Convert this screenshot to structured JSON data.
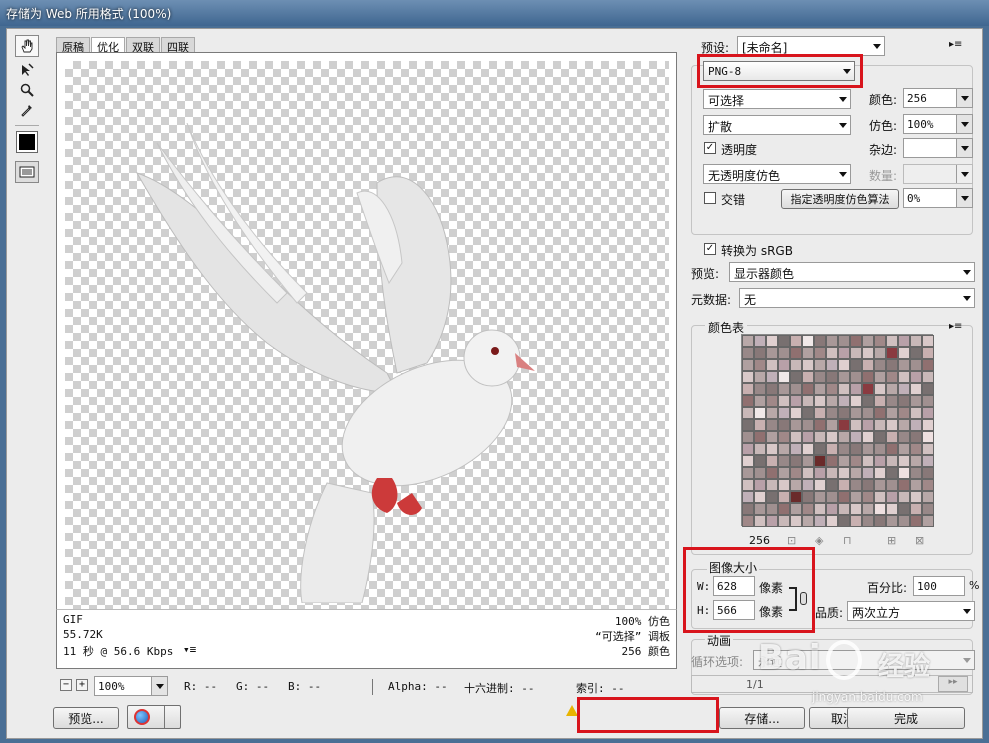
{
  "window": {
    "title": "存储为 Web 所用格式 (100%)"
  },
  "tabs": [
    "原稿",
    "优化",
    "双联",
    "四联"
  ],
  "info": {
    "format": "GIF",
    "size": "55.72K",
    "time": "11 秒 @ 56.6 Kbps",
    "dither": "100% 仿色",
    "palette": "“可选择” 调板",
    "colors": "256 颜色"
  },
  "status": {
    "zoom": "100%",
    "r": "R: --",
    "g": "G: --",
    "b": "B: --",
    "alpha": "Alpha: --",
    "hex": "十六进制: --",
    "index": "索引: --"
  },
  "buttons": {
    "preview": "预览...",
    "save": "存储...",
    "cancel": "取消",
    "done": "完成"
  },
  "settings": {
    "preset_label": "预设:",
    "preset_value": "[未命名]",
    "format": "PNG-8",
    "reduction": "可选择",
    "dither_algo": "扩散",
    "colors_label": "颜色:",
    "colors_value": "256",
    "dither_label": "仿色:",
    "dither_value": "100%",
    "transparency": "透明度",
    "matte_label": "杂边:",
    "matte_value": "",
    "trans_dither": "无透明度仿色",
    "amount_label": "数量:",
    "amount_value": "",
    "interlaced": "交错",
    "trans_dither_btn": "指定透明度仿色算法",
    "websnap_value": "0%",
    "convert_srgb": "转换为 sRGB",
    "preview_label": "预览:",
    "preview_value": "显示器颜色",
    "metadata_label": "元数据:",
    "metadata_value": "无"
  },
  "color_table": {
    "title": "颜色表",
    "count": "256",
    "colors": [
      "#b8a8a8",
      "#a89898",
      "#c8b8b8",
      "#988888",
      "#d0c0c0",
      "#787070",
      "#b0a0a0",
      "#c0b0b8",
      "#a09090",
      "#d8c8c8",
      "#887878",
      "#b8a0a8",
      "#c8b0b0",
      "#a08888",
      "#e0d0d0",
      "#907070"
    ]
  },
  "image_size": {
    "title": "图像大小",
    "w_label": "W:",
    "w_value": "628",
    "h_label": "H:",
    "h_value": "566",
    "unit": "像素",
    "percent_label": "百分比:",
    "percent_value": "100",
    "percent_unit": "%",
    "quality_label": "品质:",
    "quality_value": "两次立方"
  },
  "animation": {
    "title": "动画",
    "loop_label": "循环选项:",
    "loop_value": "永远",
    "frame": "1/1"
  },
  "watermark": {
    "brand": "Bai",
    "brand2": "经验",
    "url": "jingyan.baidu.com"
  }
}
